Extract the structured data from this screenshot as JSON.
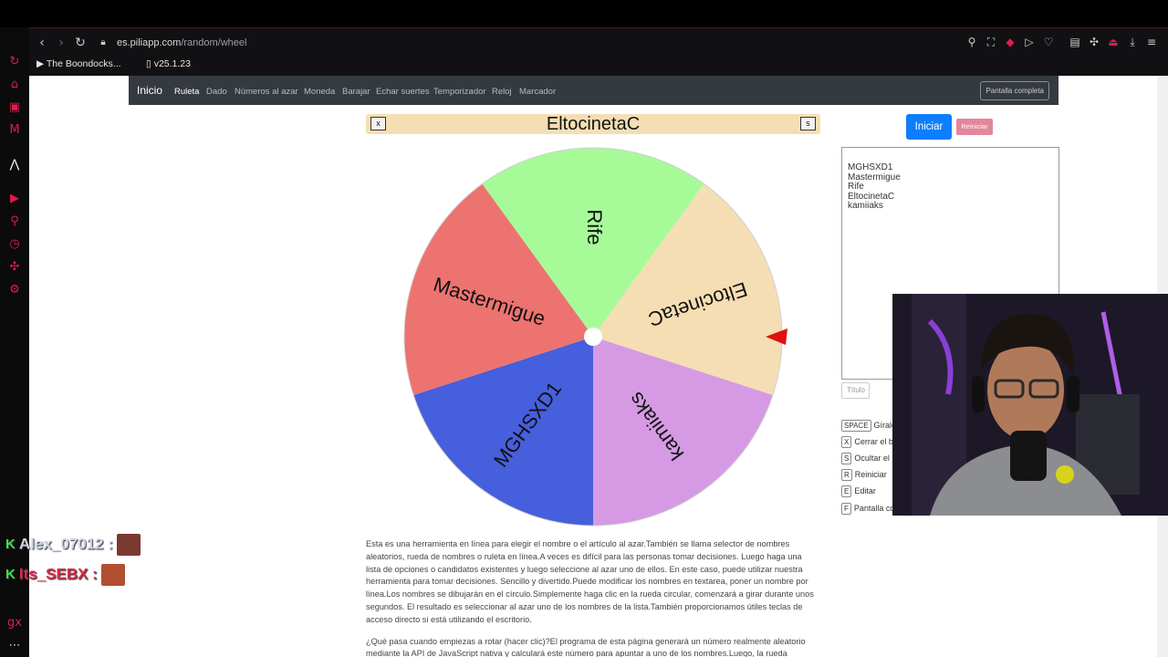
{
  "browser": {
    "url_host": "es.piliapp.com",
    "url_path": "/random/wheel",
    "bookmarks": [
      "The Boondocks...",
      "v25.1.23"
    ]
  },
  "navbar": {
    "brand": "Inicio",
    "links": [
      "Ruleta",
      "Dado",
      "Números al azar",
      "Moneda",
      "Barajar",
      "Echar suertes",
      "Temporizador",
      "Reloj",
      "Marcador"
    ],
    "fullscreen": "Pantalla completa"
  },
  "wheel_title": {
    "close_key": "x",
    "hide_key": "s",
    "text": "EltocinetaC"
  },
  "wheel": {
    "segments": [
      {
        "label": "Rife",
        "color": "#a6fb98"
      },
      {
        "label": "EltocinetaC",
        "color": "#f5deb3"
      },
      {
        "label": "kamiiaks",
        "color": "#d59ae3"
      },
      {
        "label": "MGHSXD1",
        "color": "#465fdc"
      },
      {
        "label": "Mastermigue",
        "color": "#ed7370"
      }
    ],
    "pointer_color": "#e01010"
  },
  "controls": {
    "start": "Iniciar",
    "reset": "Reiniciar",
    "title_placeholder": "Título"
  },
  "names_list": [
    "MGHSXD1",
    "Mastermigue",
    "Rife",
    "EltocinetaC",
    "kamiiaks"
  ],
  "hotkeys": [
    {
      "key": "SPACE",
      "label": "Gíralo"
    },
    {
      "key": "X",
      "label": "Cerrar el b"
    },
    {
      "key": "S",
      "label": "Ocultar el"
    },
    {
      "key": "R",
      "label": "Reiniciar"
    },
    {
      "key": "E",
      "label": "Editar"
    },
    {
      "key": "F",
      "label": "Pantalla co"
    }
  ],
  "description": [
    "Esta es una herramienta en línea para elegir el nombre o el artículo al azar.También se llama selector de nombres aleatorios, rueda de nombres o ruleta en línea.A veces es difícil para las personas tomar decisiones. Luego haga una lista de opciones o candidatos existentes y luego seleccione al azar uno de ellos. En este caso, puede utilizar nuestra herramienta para tomar decisiones. Sencillo y divertido.Puede modificar los nombres en textarea, poner un nombre por línea.Los nombres se dibujarán en el círculo.Simplemente haga clic en la rueda circular, comenzará a girar durante unos segundos. El resultado es seleccionar al azar uno de los nombres de la lista.También proporcionamos útiles teclas de acceso directo si está utilizando el escritorio.",
    "¿Qué pasa cuando empiezas a rotar (hacer clic)?El programa de esta página generará un número realmente aleatorio mediante la API de JavaScript nativa y calculará este número para apuntar a uno de los nombres.Luego, la rueda circular"
  ],
  "chat": [
    {
      "user": "Alex_07012",
      "sep": ":"
    },
    {
      "user": "Its_SEBX",
      "sep": ":"
    }
  ]
}
